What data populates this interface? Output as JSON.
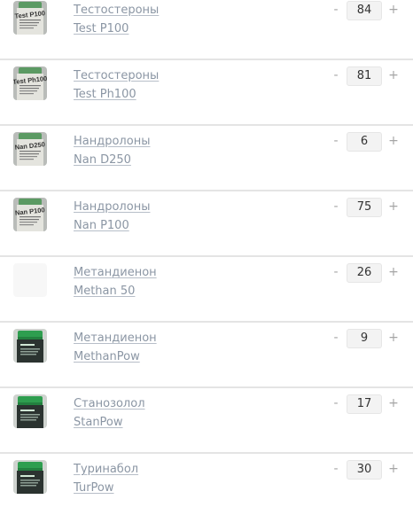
{
  "items": [
    {
      "category": "Тестостероны",
      "product": "Test P100",
      "quantity": "84",
      "image": "test-p100-vial",
      "thumb_style": "grey-vial",
      "label": "Test P100"
    },
    {
      "category": "Тестостероны",
      "product": "Test Ph100",
      "quantity": "81",
      "image": "test-ph100-vial",
      "thumb_style": "grey-vial",
      "label": "Test Ph100"
    },
    {
      "category": "Нандролоны",
      "product": "Nan D250",
      "quantity": "6",
      "image": "nan-d250-vial",
      "thumb_style": "grey-vial",
      "label": "Nan D250"
    },
    {
      "category": "Нандролоны",
      "product": "Nan P100",
      "quantity": "75",
      "image": "nan-p100-vial",
      "thumb_style": "grey-vial",
      "label": "Nan P100"
    },
    {
      "category": "Метандиенон",
      "product": "Methan 50",
      "quantity": "26",
      "image": "image-placeholder",
      "thumb_style": "blank",
      "label": ""
    },
    {
      "category": "Метандиенон",
      "product": "MethanPow",
      "quantity": "9",
      "image": "methanpow-jar",
      "thumb_style": "green-jar",
      "label": ""
    },
    {
      "category": "Станозолол",
      "product": "StanPow",
      "quantity": "17",
      "image": "stanpow-jar",
      "thumb_style": "green-jar",
      "label": ""
    },
    {
      "category": "Туринабол",
      "product": "TurPow",
      "quantity": "30",
      "image": "turpow-jar",
      "thumb_style": "green-jar",
      "label": ""
    }
  ],
  "controls": {
    "minus": "-",
    "plus": "+"
  },
  "colors": {
    "link": "#8b96a4",
    "separator": "#e4e4e4",
    "quantity_bg": "#f3f3f3",
    "jar_cap": "#2e9e4f"
  }
}
